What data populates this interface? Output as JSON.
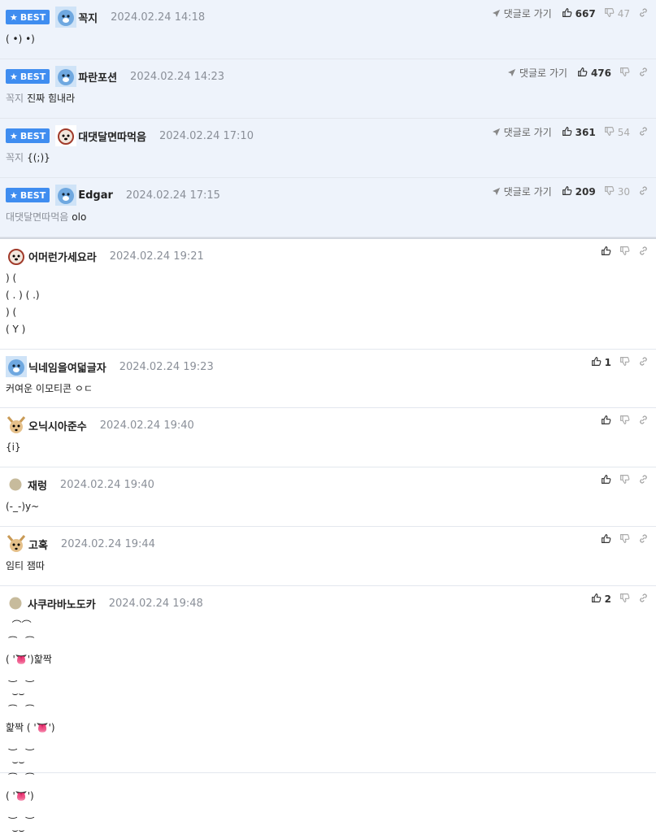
{
  "colors": {
    "accent": "#3f8df0",
    "best_bg": "#eef3fb",
    "muted": "#8a8f98"
  },
  "best_badge": "BEST",
  "reply_label": "댓글로 가기",
  "best": [
    {
      "nick": "꼭지",
      "date": "2024.02.24 14:18",
      "up": "667",
      "down": "47",
      "mention": "",
      "text": "( •) •)",
      "avatar": "blue-bear-avatar"
    },
    {
      "nick": "파란포션",
      "date": "2024.02.24 14:23",
      "up": "476",
      "down": "",
      "mention": "꼭지",
      "text": "진짜 힘내라",
      "avatar": "blue-bear-avatar"
    },
    {
      "nick": "대댓달면따먹음",
      "date": "2024.02.24 17:10",
      "up": "361",
      "down": "54",
      "mention": "꼭지",
      "text": "{(;)}",
      "avatar": "dog-avatar"
    },
    {
      "nick": "Edgar",
      "date": "2024.02.24 17:15",
      "up": "209",
      "down": "30",
      "mention": "대댓달면따먹음",
      "text": "olo",
      "avatar": "blue-bear-avatar"
    }
  ],
  "comments": [
    {
      "nick": "어머런가세요라",
      "date": "2024.02.24 19:21",
      "up": "",
      "text": ") (\n( . ) ( .)\n) (\n( Y )",
      "avatar": "dog-avatar"
    },
    {
      "nick": "닉네임을여덟글자",
      "date": "2024.02.24 19:23",
      "up": "1",
      "text": "커여운 이모티콘 ㅇㄷ",
      "avatar": "blue-bear-avatar"
    },
    {
      "nick": "오닉시아준수",
      "date": "2024.02.24 19:40",
      "up": "",
      "text": "{i}",
      "avatar": "chihuahua-avatar"
    },
    {
      "nick": "재렁",
      "date": "2024.02.24 19:40",
      "up": "",
      "text": "(-_-)y~",
      "avatar": "default-avatar"
    },
    {
      "nick": "고혹",
      "date": "2024.02.24 19:44",
      "up": "",
      "text": "임티 잼따",
      "avatar": "chihuahua-avatar"
    },
    {
      "nick": "사쿠라바노도카",
      "date": "2024.02.24 19:48",
      "up": "2",
      "text": "  ⌒⌒\n ⁀   ⁀\n( '👅')핥짝\n ‿   ‿\n  ⌣⌣\n ⁀   ⁀\n핥짝 ( '👅')\n ‿   ‿\n  ⌣⌣\n ⁀   ⁀\n( '👅')\n ‿   ‿\n  ⌣⌣",
      "avatar": "default-avatar"
    }
  ]
}
